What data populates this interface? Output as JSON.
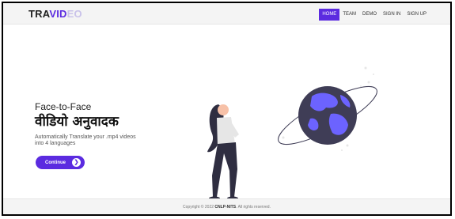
{
  "brand": {
    "part1": "TRA",
    "part2": "VID",
    "part3": "EO"
  },
  "nav": {
    "items": [
      "HOME",
      "TEAM",
      "DEMO",
      "SIGN IN",
      "SIGN UP"
    ]
  },
  "hero": {
    "title_line1": "Face-to-Face",
    "title_line2": "वीडियो अनुवादक",
    "subtitle": "Automatically Translate your .mp4 videos into 4 languages",
    "cta_label": "Continue"
  },
  "footer": {
    "prefix": "Copyright © 2022 ",
    "org": "CNLP-NITS",
    "suffix": ". All rights reserved."
  },
  "colors": {
    "accent": "#5b2be0",
    "globe": "#3f3d56"
  }
}
